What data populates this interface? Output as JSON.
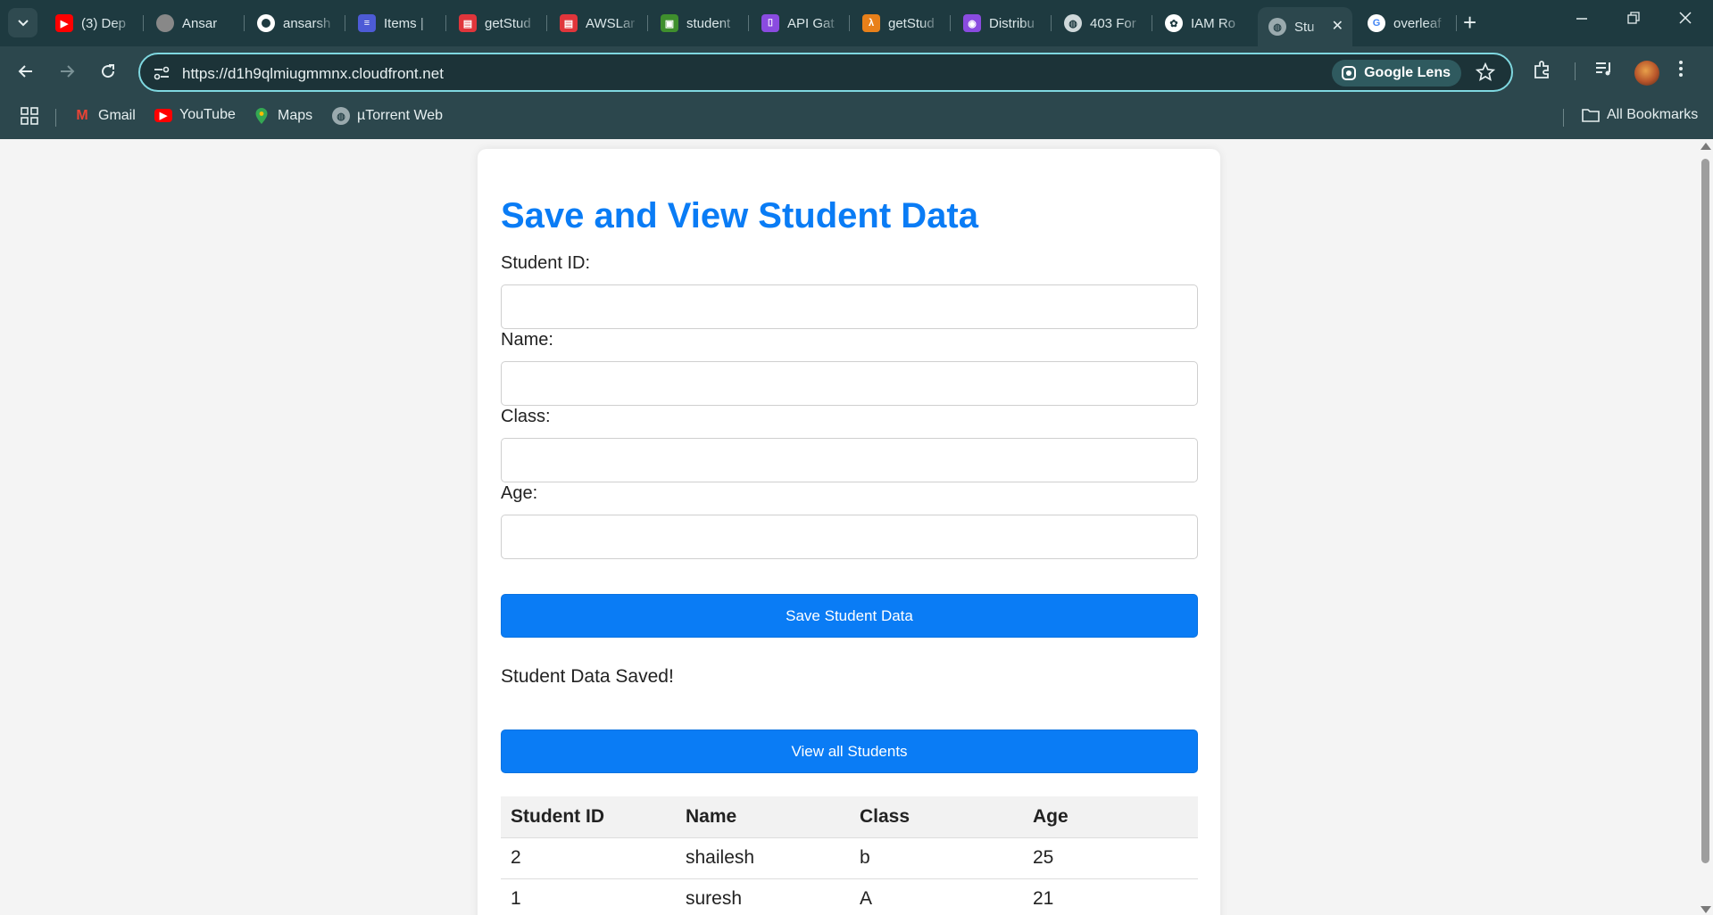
{
  "browser": {
    "tabs": [
      {
        "label": "(3) Dep",
        "icon": "youtube-icon",
        "color": "#ff0000"
      },
      {
        "label": "Ansar",
        "icon": "profile-avatar-icon",
        "color": "#888888"
      },
      {
        "label": "ansarsh",
        "icon": "github-icon",
        "color": "#ffffff"
      },
      {
        "label": "Items |",
        "icon": "dynamodb-icon",
        "color": "#4d5bd6"
      },
      {
        "label": "getStud",
        "icon": "aws-lambda-red-icon",
        "color": "#e0353b"
      },
      {
        "label": "AWSLar",
        "icon": "aws-lambda-red-icon",
        "color": "#e0353b"
      },
      {
        "label": "student",
        "icon": "s3-bucket-icon",
        "color": "#3f8f2d"
      },
      {
        "label": "API Gat",
        "icon": "api-gateway-icon",
        "color": "#8a4be0"
      },
      {
        "label": "getStud",
        "icon": "lambda-icon",
        "color": "#e8801a"
      },
      {
        "label": "Distribu",
        "icon": "cloudfront-icon",
        "color": "#8a4be0"
      },
      {
        "label": "403 For",
        "icon": "globe-icon",
        "color": "#cfd8da"
      },
      {
        "label": "IAM Ro",
        "icon": "openai-icon",
        "color": "#ffffff"
      }
    ],
    "active_tab": {
      "label": "Stu",
      "icon": "globe-icon"
    },
    "after_tab": {
      "label": "overleaf",
      "icon": "google-icon"
    },
    "url": "https://d1h9qlmiugmmnx.cloudfront.net",
    "lens_label": "Google Lens",
    "bookmarks": [
      {
        "label": "Gmail",
        "icon": "gmail-icon"
      },
      {
        "label": "YouTube",
        "icon": "youtube-icon"
      },
      {
        "label": "Maps",
        "icon": "maps-pin-icon"
      },
      {
        "label": "µTorrent Web",
        "icon": "globe-icon"
      }
    ],
    "all_bookmarks": "All Bookmarks"
  },
  "page": {
    "title": "Save and View Student Data",
    "fields": [
      {
        "label": "Student ID:",
        "value": ""
      },
      {
        "label": "Name:",
        "value": ""
      },
      {
        "label": "Class:",
        "value": ""
      },
      {
        "label": "Age:",
        "value": ""
      }
    ],
    "save_button": "Save Student Data",
    "status_message": "Student Data Saved!",
    "view_button": "View all Students",
    "table": {
      "headers": [
        "Student ID",
        "Name",
        "Class",
        "Age"
      ],
      "rows": [
        [
          "2",
          "shailesh",
          "b",
          "25"
        ],
        [
          "1",
          "suresh",
          "A",
          "21"
        ]
      ]
    }
  },
  "colors": {
    "accent": "#0a7cf5",
    "chrome": "#2c474d",
    "tabstrip": "#1e3a40"
  }
}
